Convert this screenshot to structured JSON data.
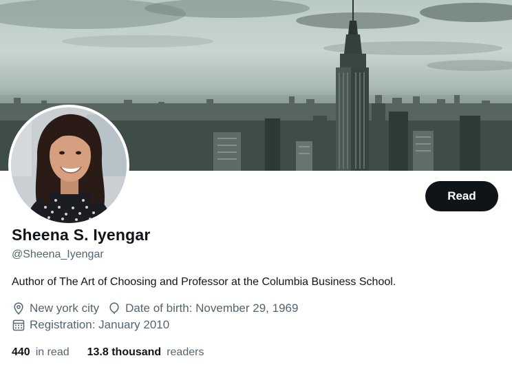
{
  "profile": {
    "name": "Sheena S. Iyengar",
    "handle": "@Sheena_Iyengar",
    "bio": "Author of The Art of Choosing and Professor at the Columbia Business School.",
    "location": "New york city",
    "birth": "Date of birth: November 29, 1969",
    "registration": "Registration: January 2010"
  },
  "actions": {
    "read_label": "Read"
  },
  "stats": {
    "following_count": "440",
    "following_label": "in read",
    "followers_count": "13.8 thousand",
    "followers_label": "readers"
  },
  "icons": {
    "location": "location-pin-icon",
    "birth": "balloon-icon",
    "registration": "calendar-icon"
  },
  "colors": {
    "primary_text": "#0f1419",
    "secondary_text": "#536471",
    "button_bg": "#0f1419",
    "button_text": "#ffffff"
  }
}
